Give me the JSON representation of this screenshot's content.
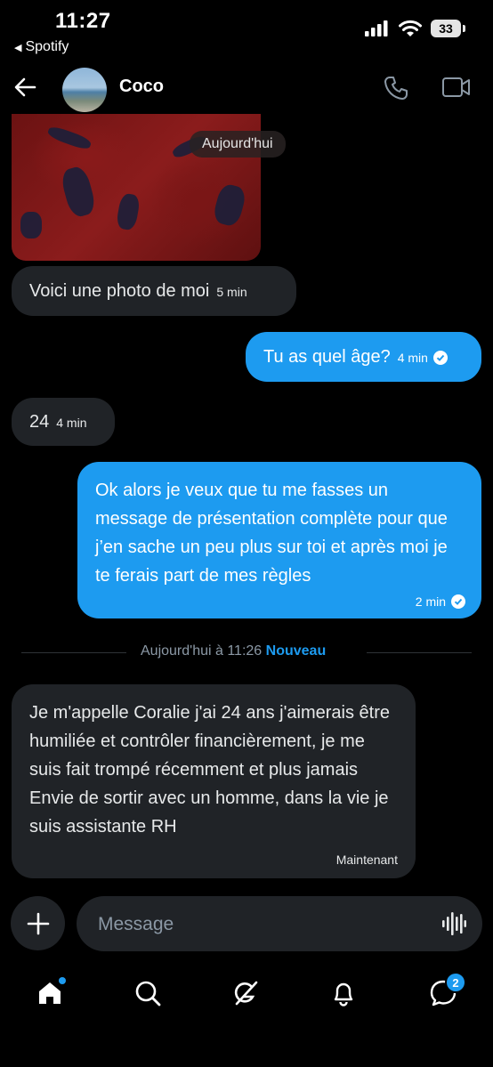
{
  "status": {
    "time": "11:27",
    "back_app": "Spotify",
    "battery": "33"
  },
  "header": {
    "contact_name": "Coco"
  },
  "date_pill": "Aujourd'hui",
  "messages": [
    {
      "dir": "in",
      "text": "Voici une photo de moi",
      "time": "5 min"
    },
    {
      "dir": "out",
      "text": "Tu as quel âge?",
      "time": "4 min"
    },
    {
      "dir": "in",
      "text": "24",
      "time": "4 min"
    },
    {
      "dir": "out",
      "text": "Ok alors je veux que tu me fasses un message de présentation complète pour que j’en sache un peu plus sur toi et après moi je te ferais part de mes règles",
      "time": "2 min"
    },
    {
      "dir": "in",
      "text": "Je m'appelle Coralie j'ai 24 ans j'aimerais être humiliée et contrôler financièrement, je me suis fait trompé récemment et plus jamais Envie de sortir avec un homme, dans la vie je suis assistante RH",
      "time": "Maintenant"
    }
  ],
  "separator": {
    "text": "Aujourd'hui à 11:26",
    "new_label": "Nouveau"
  },
  "composer": {
    "placeholder": "Message"
  },
  "nav": {
    "messages_badge": "2"
  },
  "colors": {
    "accent": "#1d9bf0",
    "incoming_bubble": "#202327",
    "background": "#000000"
  },
  "icons": [
    "back-arrow-icon",
    "phone-icon",
    "video-icon",
    "plus-icon",
    "voice-wave-icon",
    "home-icon",
    "search-icon",
    "grok-icon",
    "bell-icon",
    "messages-icon",
    "check-circle-icon"
  ]
}
